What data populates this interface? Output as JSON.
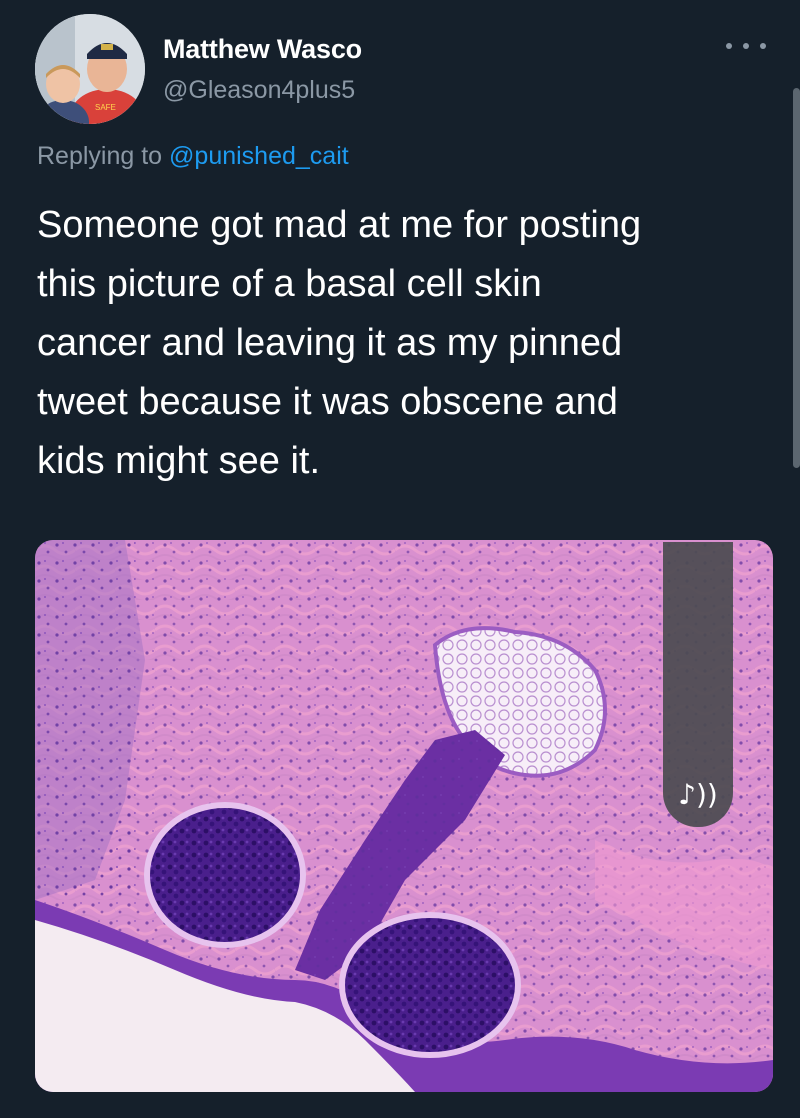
{
  "author": {
    "name": "Matthew Wasco",
    "handle": "@Gleason4plus5"
  },
  "reply": {
    "prefix": "Replying to ",
    "mention": "@punished_cait"
  },
  "tweet": {
    "text": "Someone got mad at me for posting\nthis picture of a basal cell skin\ncancer and leaving it as my pinned\ntweet because it was obscene and\nkids might see it."
  },
  "media": {
    "sound_icon": "♪))"
  },
  "icons": {
    "more": "more-options-icon",
    "sound": "sound-icon"
  },
  "colors": {
    "background": "#15202b",
    "mention": "#1d9bf0",
    "secondary_text": "#8b98a5"
  }
}
